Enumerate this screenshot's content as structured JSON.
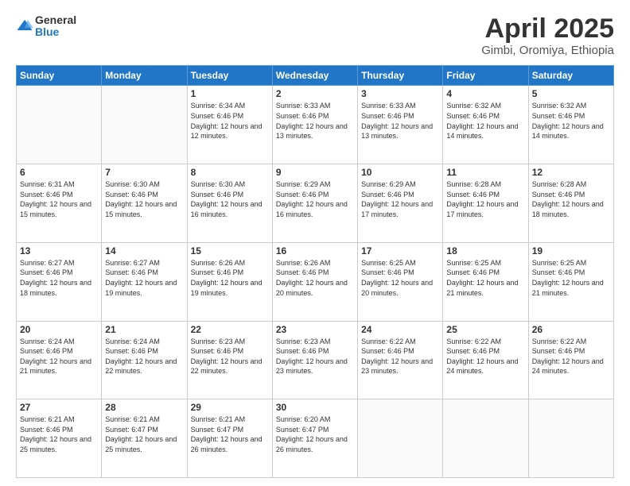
{
  "header": {
    "logo_general": "General",
    "logo_blue": "Blue",
    "title": "April 2025",
    "subtitle": "Gimbi, Oromiya, Ethiopia"
  },
  "weekdays": [
    "Sunday",
    "Monday",
    "Tuesday",
    "Wednesday",
    "Thursday",
    "Friday",
    "Saturday"
  ],
  "days": [
    {
      "num": "",
      "sunrise": "",
      "sunset": "",
      "daylight": "",
      "empty": true
    },
    {
      "num": "",
      "sunrise": "",
      "sunset": "",
      "daylight": "",
      "empty": true
    },
    {
      "num": "1",
      "sunrise": "Sunrise: 6:34 AM",
      "sunset": "Sunset: 6:46 PM",
      "daylight": "Daylight: 12 hours and 12 minutes."
    },
    {
      "num": "2",
      "sunrise": "Sunrise: 6:33 AM",
      "sunset": "Sunset: 6:46 PM",
      "daylight": "Daylight: 12 hours and 13 minutes."
    },
    {
      "num": "3",
      "sunrise": "Sunrise: 6:33 AM",
      "sunset": "Sunset: 6:46 PM",
      "daylight": "Daylight: 12 hours and 13 minutes."
    },
    {
      "num": "4",
      "sunrise": "Sunrise: 6:32 AM",
      "sunset": "Sunset: 6:46 PM",
      "daylight": "Daylight: 12 hours and 14 minutes."
    },
    {
      "num": "5",
      "sunrise": "Sunrise: 6:32 AM",
      "sunset": "Sunset: 6:46 PM",
      "daylight": "Daylight: 12 hours and 14 minutes."
    },
    {
      "num": "6",
      "sunrise": "Sunrise: 6:31 AM",
      "sunset": "Sunset: 6:46 PM",
      "daylight": "Daylight: 12 hours and 15 minutes."
    },
    {
      "num": "7",
      "sunrise": "Sunrise: 6:30 AM",
      "sunset": "Sunset: 6:46 PM",
      "daylight": "Daylight: 12 hours and 15 minutes."
    },
    {
      "num": "8",
      "sunrise": "Sunrise: 6:30 AM",
      "sunset": "Sunset: 6:46 PM",
      "daylight": "Daylight: 12 hours and 16 minutes."
    },
    {
      "num": "9",
      "sunrise": "Sunrise: 6:29 AM",
      "sunset": "Sunset: 6:46 PM",
      "daylight": "Daylight: 12 hours and 16 minutes."
    },
    {
      "num": "10",
      "sunrise": "Sunrise: 6:29 AM",
      "sunset": "Sunset: 6:46 PM",
      "daylight": "Daylight: 12 hours and 17 minutes."
    },
    {
      "num": "11",
      "sunrise": "Sunrise: 6:28 AM",
      "sunset": "Sunset: 6:46 PM",
      "daylight": "Daylight: 12 hours and 17 minutes."
    },
    {
      "num": "12",
      "sunrise": "Sunrise: 6:28 AM",
      "sunset": "Sunset: 6:46 PM",
      "daylight": "Daylight: 12 hours and 18 minutes."
    },
    {
      "num": "13",
      "sunrise": "Sunrise: 6:27 AM",
      "sunset": "Sunset: 6:46 PM",
      "daylight": "Daylight: 12 hours and 18 minutes."
    },
    {
      "num": "14",
      "sunrise": "Sunrise: 6:27 AM",
      "sunset": "Sunset: 6:46 PM",
      "daylight": "Daylight: 12 hours and 19 minutes."
    },
    {
      "num": "15",
      "sunrise": "Sunrise: 6:26 AM",
      "sunset": "Sunset: 6:46 PM",
      "daylight": "Daylight: 12 hours and 19 minutes."
    },
    {
      "num": "16",
      "sunrise": "Sunrise: 6:26 AM",
      "sunset": "Sunset: 6:46 PM",
      "daylight": "Daylight: 12 hours and 20 minutes."
    },
    {
      "num": "17",
      "sunrise": "Sunrise: 6:25 AM",
      "sunset": "Sunset: 6:46 PM",
      "daylight": "Daylight: 12 hours and 20 minutes."
    },
    {
      "num": "18",
      "sunrise": "Sunrise: 6:25 AM",
      "sunset": "Sunset: 6:46 PM",
      "daylight": "Daylight: 12 hours and 21 minutes."
    },
    {
      "num": "19",
      "sunrise": "Sunrise: 6:25 AM",
      "sunset": "Sunset: 6:46 PM",
      "daylight": "Daylight: 12 hours and 21 minutes."
    },
    {
      "num": "20",
      "sunrise": "Sunrise: 6:24 AM",
      "sunset": "Sunset: 6:46 PM",
      "daylight": "Daylight: 12 hours and 21 minutes."
    },
    {
      "num": "21",
      "sunrise": "Sunrise: 6:24 AM",
      "sunset": "Sunset: 6:46 PM",
      "daylight": "Daylight: 12 hours and 22 minutes."
    },
    {
      "num": "22",
      "sunrise": "Sunrise: 6:23 AM",
      "sunset": "Sunset: 6:46 PM",
      "daylight": "Daylight: 12 hours and 22 minutes."
    },
    {
      "num": "23",
      "sunrise": "Sunrise: 6:23 AM",
      "sunset": "Sunset: 6:46 PM",
      "daylight": "Daylight: 12 hours and 23 minutes."
    },
    {
      "num": "24",
      "sunrise": "Sunrise: 6:22 AM",
      "sunset": "Sunset: 6:46 PM",
      "daylight": "Daylight: 12 hours and 23 minutes."
    },
    {
      "num": "25",
      "sunrise": "Sunrise: 6:22 AM",
      "sunset": "Sunset: 6:46 PM",
      "daylight": "Daylight: 12 hours and 24 minutes."
    },
    {
      "num": "26",
      "sunrise": "Sunrise: 6:22 AM",
      "sunset": "Sunset: 6:46 PM",
      "daylight": "Daylight: 12 hours and 24 minutes."
    },
    {
      "num": "27",
      "sunrise": "Sunrise: 6:21 AM",
      "sunset": "Sunset: 6:46 PM",
      "daylight": "Daylight: 12 hours and 25 minutes."
    },
    {
      "num": "28",
      "sunrise": "Sunrise: 6:21 AM",
      "sunset": "Sunset: 6:47 PM",
      "daylight": "Daylight: 12 hours and 25 minutes."
    },
    {
      "num": "29",
      "sunrise": "Sunrise: 6:21 AM",
      "sunset": "Sunset: 6:47 PM",
      "daylight": "Daylight: 12 hours and 26 minutes."
    },
    {
      "num": "30",
      "sunrise": "Sunrise: 6:20 AM",
      "sunset": "Sunset: 6:47 PM",
      "daylight": "Daylight: 12 hours and 26 minutes."
    },
    {
      "num": "",
      "sunrise": "",
      "sunset": "",
      "daylight": "",
      "empty": true
    },
    {
      "num": "",
      "sunrise": "",
      "sunset": "",
      "daylight": "",
      "empty": true
    },
    {
      "num": "",
      "sunrise": "",
      "sunset": "",
      "daylight": "",
      "empty": true
    }
  ]
}
